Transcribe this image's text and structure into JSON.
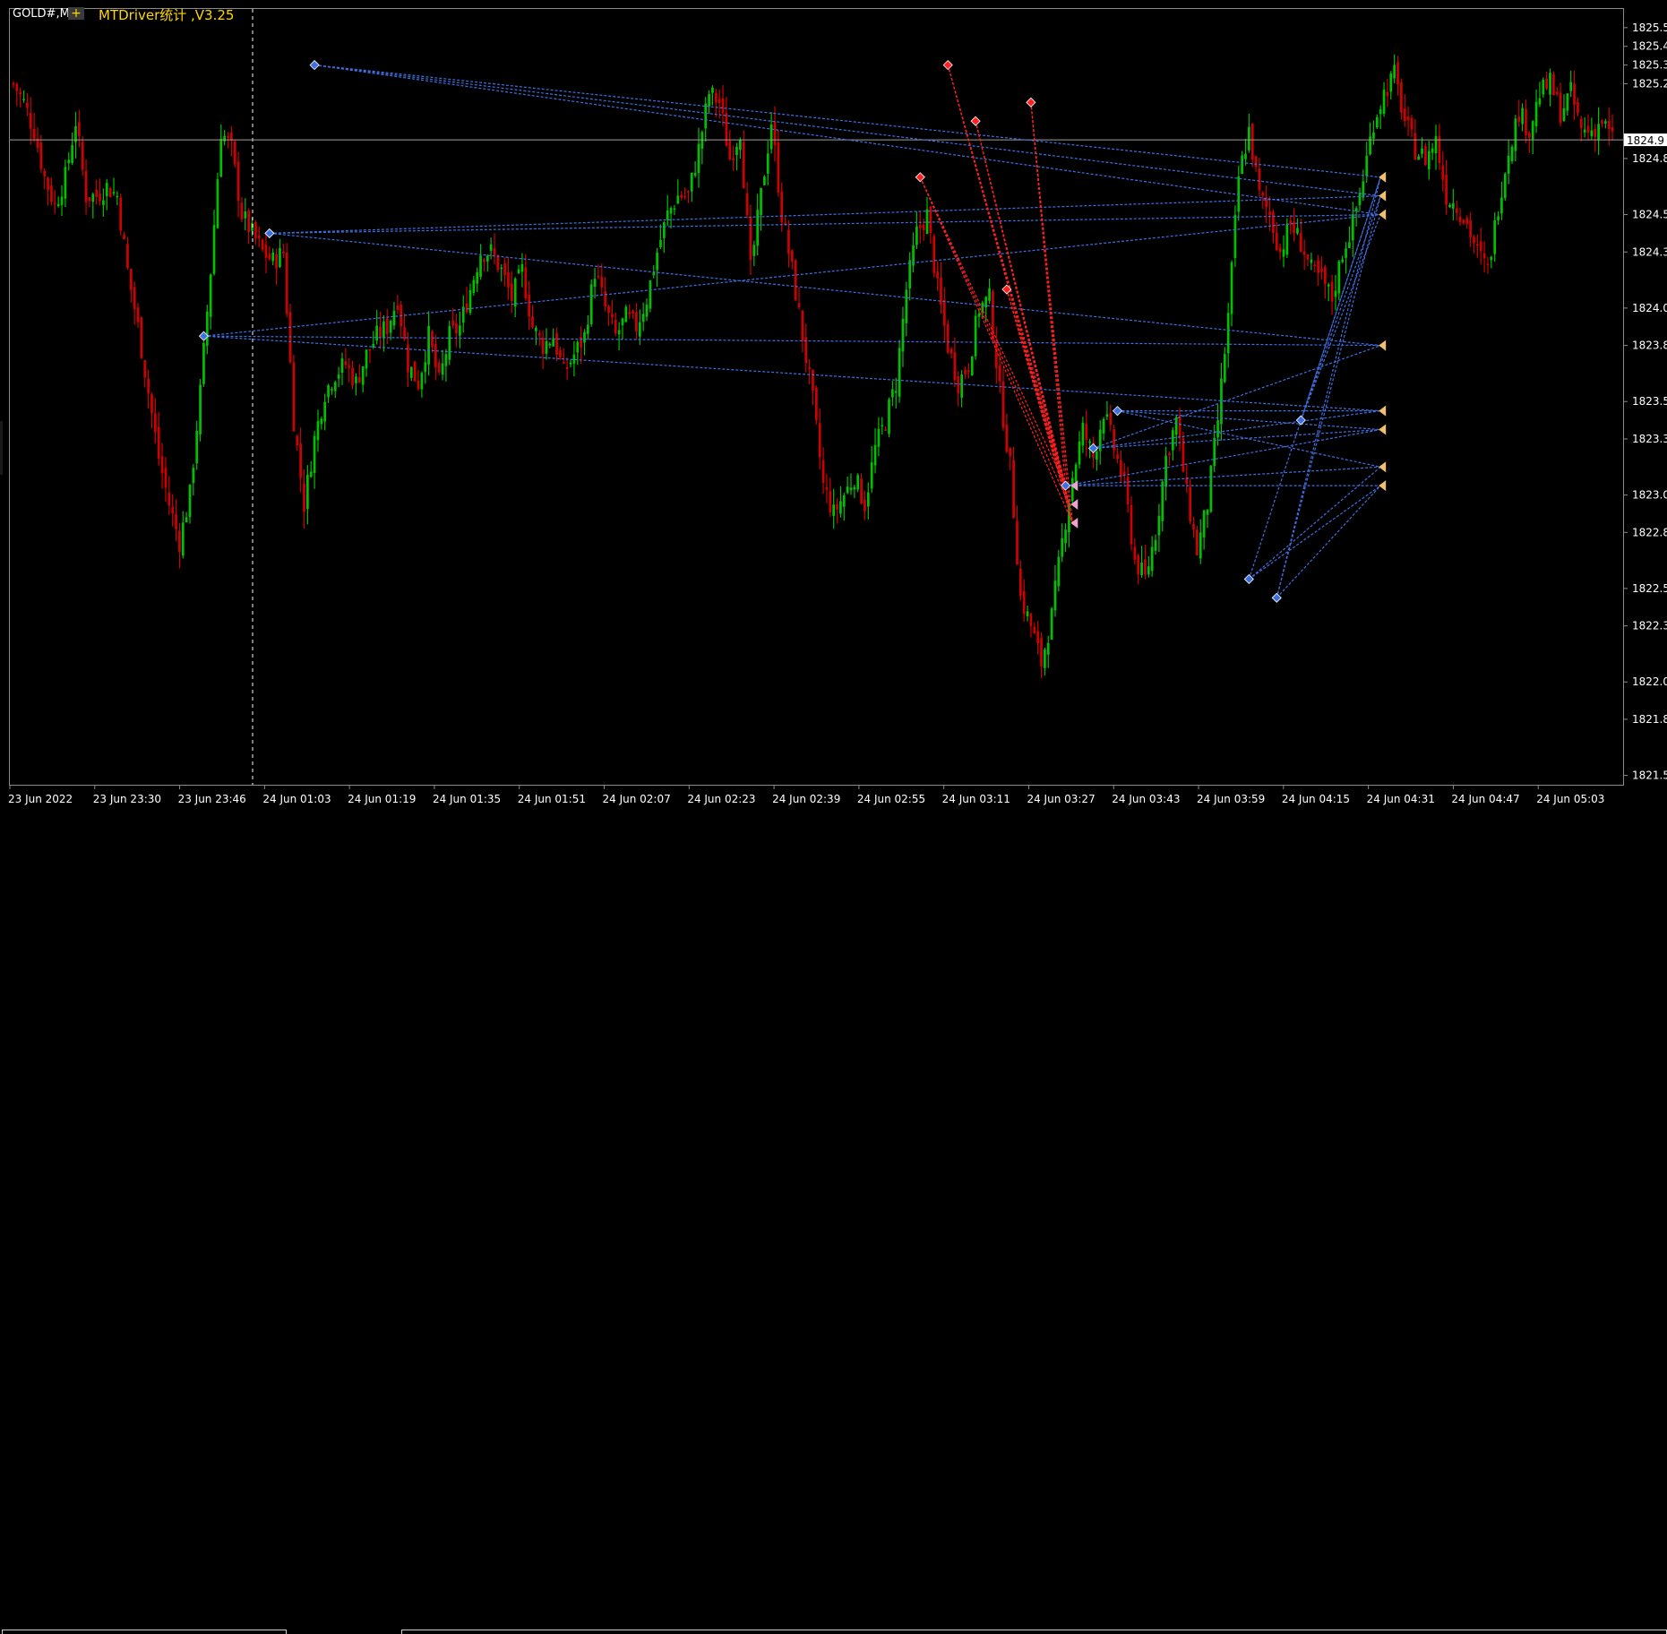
{
  "symbol_label": "GOLD#,M",
  "ea_badge": "+",
  "ea_label": "MTDriver统计 ,V3.25",
  "current_price": "1824.9",
  "colors": {
    "background": "#000000",
    "bull": "#00c000",
    "bear": "#d00000",
    "axis": "#8a8a8a",
    "blue_trade": "#3f6fe0",
    "red_trade": "#ff2020",
    "price_line": "#a0a0a0",
    "current_box": "#ffffff",
    "ea_text": "#ffd700"
  },
  "chart_data": {
    "type": "candlestick",
    "title": "",
    "ylim": [
      1821.45,
      1825.6
    ],
    "y_ticks": [
      "1825.5",
      "1825.4",
      "1825.3",
      "1825.2",
      "1824.9",
      "1824.8",
      "1824.5",
      "1824.3",
      "1824.0",
      "1823.8",
      "1823.5",
      "1823.3",
      "1823.0",
      "1822.8",
      "1822.5",
      "1822.3",
      "1822.0",
      "1821.8",
      "1821.5"
    ],
    "y_tick_values": [
      1825.5,
      1825.4,
      1825.3,
      1825.2,
      1824.9,
      1824.8,
      1824.5,
      1824.3,
      1824.0,
      1823.8,
      1823.5,
      1823.3,
      1823.0,
      1822.8,
      1822.5,
      1822.3,
      1822.0,
      1821.8,
      1821.5
    ],
    "x_labels": [
      "23 Jun 2022",
      "23 Jun 23:30",
      "23 Jun 23:46",
      "24 Jun 01:03",
      "24 Jun 01:19",
      "24 Jun 01:35",
      "24 Jun 01:51",
      "24 Jun 02:07",
      "24 Jun 02:23",
      "24 Jun 02:39",
      "24 Jun 02:55",
      "24 Jun 03:11",
      "24 Jun 03:27",
      "24 Jun 03:43",
      "24 Jun 03:59",
      "24 Jun 04:15",
      "24 Jun 04:31",
      "24 Jun 04:47",
      "24 Jun 05:03"
    ],
    "session_separator_after": "23 Jun 23:46",
    "current_price": 1824.9,
    "grid": false,
    "close_path": [
      [
        0,
        1825.2
      ],
      [
        3,
        1825.1
      ],
      [
        6,
        1824.95
      ],
      [
        9,
        1824.7
      ],
      [
        12,
        1824.55
      ],
      [
        15,
        1824.7
      ],
      [
        18,
        1825.0
      ],
      [
        21,
        1824.6
      ],
      [
        24,
        1824.6
      ],
      [
        27,
        1824.65
      ],
      [
        30,
        1824.6
      ],
      [
        33,
        1824.2
      ],
      [
        36,
        1823.9
      ],
      [
        39,
        1823.55
      ],
      [
        42,
        1823.2
      ],
      [
        45,
        1822.95
      ],
      [
        48,
        1822.75
      ],
      [
        51,
        1823.0
      ],
      [
        54,
        1823.55
      ],
      [
        57,
        1824.2
      ],
      [
        60,
        1824.95
      ],
      [
        63,
        1824.85
      ],
      [
        66,
        1824.5
      ],
      [
        69,
        1824.4
      ],
      [
        72,
        1824.3
      ],
      [
        75,
        1824.25
      ],
      [
        78,
        1824.3
      ],
      [
        81,
        1823.4
      ],
      [
        84,
        1822.95
      ],
      [
        87,
        1823.3
      ],
      [
        90,
        1823.55
      ],
      [
        93,
        1823.65
      ],
      [
        96,
        1823.7
      ],
      [
        99,
        1823.6
      ],
      [
        102,
        1823.75
      ],
      [
        105,
        1823.85
      ],
      [
        108,
        1823.9
      ],
      [
        111,
        1824.05
      ],
      [
        114,
        1823.7
      ],
      [
        117,
        1823.6
      ],
      [
        120,
        1823.85
      ],
      [
        123,
        1823.6
      ],
      [
        126,
        1823.85
      ],
      [
        129,
        1823.9
      ],
      [
        132,
        1824.1
      ],
      [
        135,
        1824.3
      ],
      [
        138,
        1824.3
      ],
      [
        141,
        1824.2
      ],
      [
        144,
        1824.05
      ],
      [
        147,
        1824.2
      ],
      [
        150,
        1823.9
      ],
      [
        153,
        1823.8
      ],
      [
        156,
        1823.85
      ],
      [
        159,
        1823.65
      ],
      [
        162,
        1823.75
      ],
      [
        165,
        1823.85
      ],
      [
        168,
        1824.2
      ],
      [
        171,
        1824.0
      ],
      [
        174,
        1823.85
      ],
      [
        177,
        1823.95
      ],
      [
        180,
        1823.9
      ],
      [
        183,
        1824.05
      ],
      [
        186,
        1824.3
      ],
      [
        189,
        1824.5
      ],
      [
        192,
        1824.6
      ],
      [
        195,
        1824.6
      ],
      [
        198,
        1824.85
      ],
      [
        201,
        1825.15
      ],
      [
        204,
        1825.1
      ],
      [
        207,
        1824.8
      ],
      [
        210,
        1824.95
      ],
      [
        213,
        1824.2
      ],
      [
        216,
        1824.6
      ],
      [
        219,
        1825.0
      ],
      [
        222,
        1824.5
      ],
      [
        225,
        1824.2
      ],
      [
        228,
        1823.85
      ],
      [
        231,
        1823.5
      ],
      [
        234,
        1823.05
      ],
      [
        237,
        1822.9
      ],
      [
        240,
        1823.0
      ],
      [
        243,
        1823.1
      ],
      [
        246,
        1822.95
      ],
      [
        249,
        1823.25
      ],
      [
        252,
        1823.4
      ],
      [
        255,
        1823.6
      ],
      [
        258,
        1824.1
      ],
      [
        261,
        1824.4
      ],
      [
        264,
        1824.5
      ],
      [
        267,
        1824.1
      ],
      [
        270,
        1823.8
      ],
      [
        273,
        1823.6
      ],
      [
        276,
        1823.7
      ],
      [
        279,
        1824.0
      ],
      [
        282,
        1824.05
      ],
      [
        285,
        1823.55
      ],
      [
        288,
        1823.15
      ],
      [
        291,
        1822.45
      ],
      [
        294,
        1822.3
      ],
      [
        297,
        1822.1
      ],
      [
        300,
        1822.35
      ],
      [
        303,
        1822.75
      ],
      [
        306,
        1823.1
      ],
      [
        309,
        1823.35
      ],
      [
        312,
        1823.2
      ],
      [
        315,
        1823.45
      ],
      [
        318,
        1823.25
      ],
      [
        321,
        1823.05
      ],
      [
        324,
        1822.65
      ],
      [
        327,
        1822.55
      ],
      [
        330,
        1822.8
      ],
      [
        333,
        1823.2
      ],
      [
        336,
        1823.4
      ],
      [
        339,
        1823.0
      ],
      [
        342,
        1822.7
      ],
      [
        345,
        1822.95
      ],
      [
        348,
        1823.4
      ],
      [
        351,
        1823.95
      ],
      [
        354,
        1824.7
      ],
      [
        357,
        1824.95
      ],
      [
        360,
        1824.6
      ],
      [
        363,
        1824.5
      ],
      [
        366,
        1824.3
      ],
      [
        369,
        1824.45
      ],
      [
        372,
        1824.35
      ],
      [
        375,
        1824.2
      ],
      [
        378,
        1824.15
      ],
      [
        381,
        1824.05
      ],
      [
        384,
        1824.3
      ],
      [
        387,
        1824.45
      ],
      [
        390,
        1824.7
      ],
      [
        393,
        1825.0
      ],
      [
        396,
        1825.15
      ],
      [
        399,
        1825.25
      ],
      [
        402,
        1825.0
      ],
      [
        405,
        1824.85
      ],
      [
        408,
        1824.8
      ],
      [
        411,
        1824.9
      ],
      [
        414,
        1824.6
      ],
      [
        417,
        1824.55
      ],
      [
        420,
        1824.45
      ],
      [
        423,
        1824.3
      ],
      [
        426,
        1824.2
      ],
      [
        429,
        1824.55
      ],
      [
        432,
        1824.85
      ],
      [
        435,
        1825.05
      ],
      [
        438,
        1824.95
      ],
      [
        441,
        1825.15
      ],
      [
        444,
        1825.2
      ],
      [
        447,
        1825.05
      ],
      [
        450,
        1825.15
      ],
      [
        453,
        1824.95
      ],
      [
        456,
        1824.95
      ],
      [
        459,
        1825.0
      ],
      [
        462,
        1824.9
      ]
    ],
    "last_bar_index": 462,
    "blue_trade_markers": [
      {
        "bar": 87,
        "price": 1825.3
      },
      {
        "bar": 74,
        "price": 1824.4
      },
      {
        "bar": 55,
        "price": 1823.85
      },
      {
        "bar": 312,
        "price": 1823.25
      },
      {
        "bar": 319,
        "price": 1823.45
      },
      {
        "bar": 304,
        "price": 1823.05
      },
      {
        "bar": 357,
        "price": 1822.55
      },
      {
        "bar": 365,
        "price": 1822.45
      },
      {
        "bar": 372,
        "price": 1823.4
      }
    ],
    "red_trade_markers": [
      {
        "bar": 270,
        "price": 1825.3
      },
      {
        "bar": 278,
        "price": 1825.0
      },
      {
        "bar": 262,
        "price": 1824.7
      },
      {
        "bar": 294,
        "price": 1825.1
      },
      {
        "bar": 287,
        "price": 1824.1
      }
    ],
    "exit_anchor": {
      "bar": 395,
      "price": 1824.7
    },
    "exit_markers_prices": [
      1824.7,
      1824.6,
      1824.5,
      1823.8,
      1823.45,
      1823.35,
      1823.15,
      1823.05
    ]
  }
}
